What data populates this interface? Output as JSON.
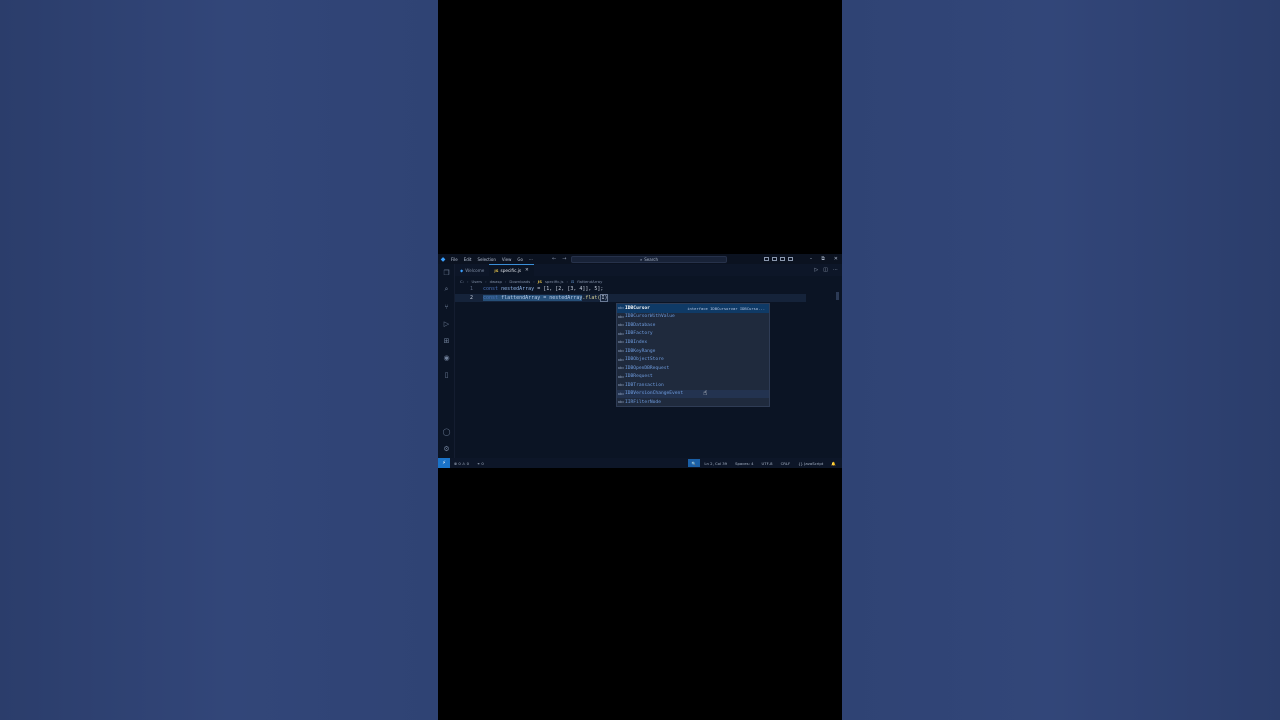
{
  "titlebar": {
    "menu": [
      "File",
      "Edit",
      "Selection",
      "View",
      "Go",
      "···"
    ],
    "search_placeholder": "Search"
  },
  "tabs": [
    {
      "label": "Welcome",
      "active": false
    },
    {
      "label": "specific.js",
      "active": true,
      "icon": "JS"
    }
  ],
  "breadcrumb": [
    "C:",
    "Users",
    "dwasp",
    "Downloads",
    "specific.js",
    "flattendArray"
  ],
  "breadcrumb_js_icon": "JS",
  "editor": {
    "lines": [
      {
        "num": "1",
        "kw": "const",
        "name": "nestedArray",
        "rest": " = [1, [2, [3, 4]], 5];"
      },
      {
        "num": "2",
        "kw": "const",
        "name": "flattendArray",
        "rest_sel": " = nestedArray",
        "method": ".flat(",
        "close": "I)"
      }
    ]
  },
  "suggestions": [
    {
      "label": "IDBCursor",
      "detail": "interface IDBCursorvar IDBCurso..."
    },
    {
      "label": "IDBCursorWithValue"
    },
    {
      "label": "IDBDatabase"
    },
    {
      "label": "IDBFactory"
    },
    {
      "label": "IDBIndex"
    },
    {
      "label": "IDBKeyRange"
    },
    {
      "label": "IDBObjectStore"
    },
    {
      "label": "IDBOpenDBRequest"
    },
    {
      "label": "IDBRequest"
    },
    {
      "label": "IDBTransaction"
    },
    {
      "label": "IDBVersionChangeEvent"
    },
    {
      "label": "IIRFilterNode"
    }
  ],
  "suggest_icon": "abc",
  "statusbar": {
    "problems": "⊗ 0 ⚠ 0",
    "ports": "⚭ 0",
    "position": "Ln 2, Col 39",
    "spaces": "Spaces: 4",
    "encoding": "UTF-8",
    "eol": "CRLF",
    "language": "{} JavaScript"
  },
  "colors": {
    "accent": "#1a73c9",
    "background": "#0b1424",
    "page_bg": "#2f4374"
  }
}
